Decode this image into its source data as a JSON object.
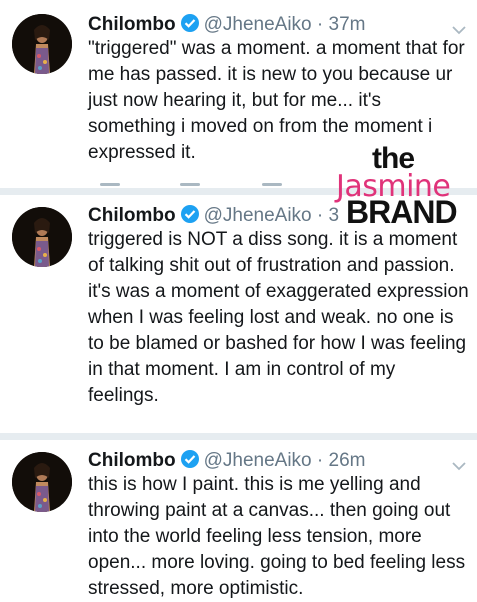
{
  "tweets": [
    {
      "name": "Chilombo",
      "handle": "@JheneAiko",
      "time": "37m",
      "text": "\"triggered\" was a moment. a moment that for me has passed. it is new to you because ur just now hearing it, but for me...  it's something i moved on from the moment i expressed it."
    },
    {
      "name": "Chilombo",
      "handle": "@JheneAiko",
      "time": "3",
      "text": "triggered is NOT a diss song. it is a moment of talking shit out of frustration and passion. it's was a moment of exaggerated expression when I was feeling lost and weak. no one is to be blamed or bashed for how I was feeling in that moment. I am in control of my feelings."
    },
    {
      "name": "Chilombo",
      "handle": "@JheneAiko",
      "time": "26m",
      "text": "this is how I paint. this is me yelling and throwing paint at a canvas... then going out into the world feeling less tension, more open... more loving. going to bed feeling less stressed, more optimistic."
    }
  ],
  "icons": {
    "verified": "verified-badge-icon",
    "more": "chevron-down-icon",
    "avatar": "avatar"
  },
  "watermark": {
    "the": "the",
    "jasmine": "Jasmine",
    "brand": "BRAND"
  },
  "colors": {
    "verified": "#1da1f2",
    "handle": "#657786",
    "divider": "#e6ecf0",
    "watermark_pink": "#e0337a"
  }
}
